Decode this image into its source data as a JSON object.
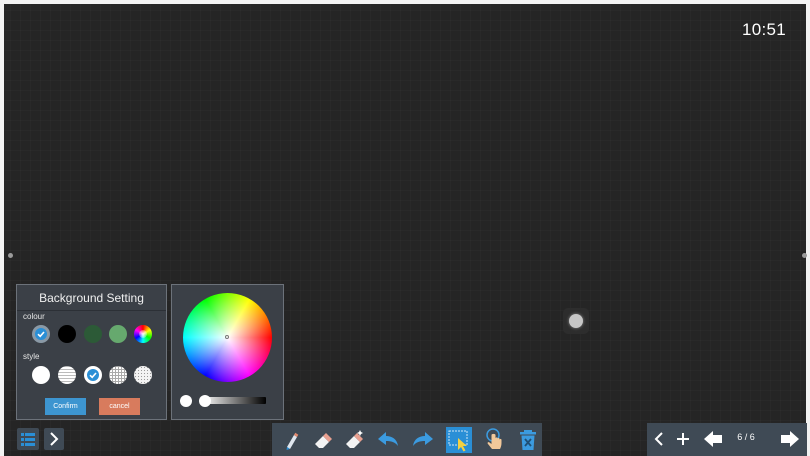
{
  "status": {
    "clock": "10:51"
  },
  "background_setting": {
    "title": "Background Setting",
    "colour_label": "colour",
    "style_label": "style",
    "colour_swatches": [
      {
        "name": "grey",
        "color": "#8a99a6",
        "selected": true
      },
      {
        "name": "black",
        "color": "#000000",
        "selected": false
      },
      {
        "name": "dark-green",
        "color": "#2c5a37",
        "selected": false
      },
      {
        "name": "light-green",
        "color": "#66a96e",
        "selected": false
      },
      {
        "name": "custom-colour-wheel",
        "color": "multicolor",
        "selected": false
      }
    ],
    "style_options": [
      {
        "name": "blank",
        "selected": false
      },
      {
        "name": "lined",
        "selected": false
      },
      {
        "name": "grid-fine",
        "selected": true
      },
      {
        "name": "grid",
        "selected": false
      },
      {
        "name": "dotted",
        "selected": false
      }
    ],
    "confirm_label": "Confirm",
    "cancel_label": "cancel"
  },
  "colours": {
    "accent": "#2a8fd6",
    "confirm": "#3d95d0",
    "cancel": "#d87b5d",
    "panel": "#3b4047",
    "toolbar": "#3f4a55",
    "canvas": "#252525"
  },
  "toolbar": {
    "tools": [
      "pen-icon",
      "eraser-icon",
      "clear-eraser-icon",
      "undo-icon",
      "redo-icon",
      "select-icon",
      "touch-icon",
      "delete-icon"
    ],
    "active_tool": "select-icon"
  },
  "pager": {
    "indicator": "6 / 6"
  }
}
